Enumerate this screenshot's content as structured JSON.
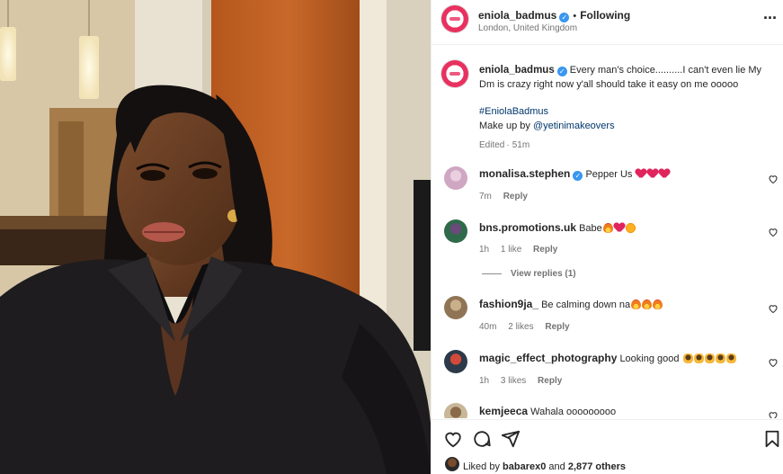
{
  "header": {
    "username": "eniola_badmus",
    "dot": "•",
    "follow_label": "Following",
    "location": "London, United Kingdom",
    "more_label": "···"
  },
  "caption": {
    "username": "eniola_badmus",
    "text": "Every man's choice..........I can't even lie My Dm is crazy right now y'all should take it easy on me ooooo",
    "hashtag": "#EniolaBadmus",
    "makeup_prefix": "Make up by",
    "mention": "@yetinimakeovers",
    "edited": "Edited",
    "time": "51m"
  },
  "comments": [
    {
      "username": "monalisa.stephen",
      "verified": true,
      "text": "Pepper Us",
      "emojis": [
        "heart",
        "heart",
        "heart"
      ],
      "time": "7m",
      "likes": "",
      "reply": "Reply"
    },
    {
      "username": "bns.promotions.uk",
      "verified": false,
      "text": "Babe",
      "emojis": [
        "fire",
        "heart",
        "star"
      ],
      "time": "1h",
      "likes": "1 like",
      "reply": "Reply"
    },
    {
      "username": "fashion9ja_",
      "verified": false,
      "text": "Be calming down na",
      "emojis": [
        "fire",
        "fire",
        "fire"
      ],
      "time": "40m",
      "likes": "2 likes",
      "reply": "Reply"
    },
    {
      "username": "magic_effect_photography",
      "verified": false,
      "text": "Looking good",
      "emojis": [
        "hands",
        "hands",
        "hands",
        "hands",
        "hands"
      ],
      "time": "1h",
      "likes": "3 likes",
      "reply": "Reply"
    },
    {
      "username": "kemjeeca",
      "verified": false,
      "text": "Wahala ooooooooo",
      "emojis": [],
      "time": "",
      "likes": "",
      "reply": ""
    }
  ],
  "view_replies": "View replies (1)",
  "likes": {
    "prefix": "Liked by",
    "user": "babarex0",
    "middle": "and",
    "count": "2,877 others"
  },
  "icons": [
    "heart-icon",
    "comment-icon",
    "share-icon",
    "bookmark-icon",
    "more-icon",
    "verified-icon"
  ],
  "colors": {
    "verified": "#3897f0",
    "link": "#00376b",
    "muted": "#737373",
    "brand": "#e8315f"
  }
}
